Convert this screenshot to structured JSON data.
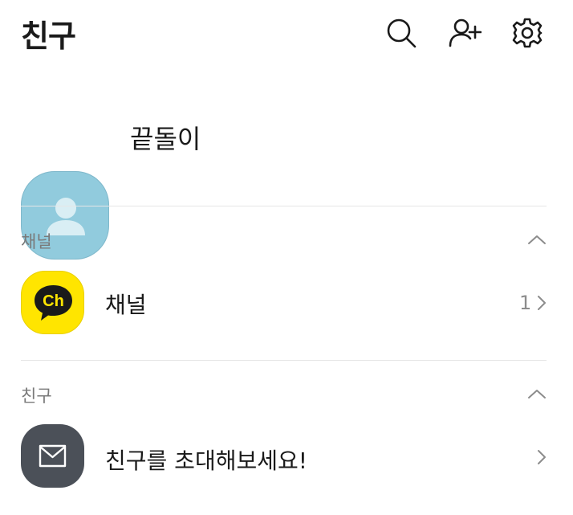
{
  "header": {
    "title": "친구",
    "icons": [
      "search-icon",
      "add-friend-icon",
      "settings-icon"
    ]
  },
  "profile": {
    "name": "끝돌이",
    "avatar_color": "#91cbdd"
  },
  "channel_section": {
    "label": "채널",
    "item": {
      "label": "채널",
      "count": "1",
      "icon_text": "Ch",
      "icon_color": "#ffe500"
    }
  },
  "friends_section": {
    "label": "친구",
    "invite": {
      "label": "친구를 초대해보세요!",
      "icon_color": "#4b5058"
    }
  }
}
